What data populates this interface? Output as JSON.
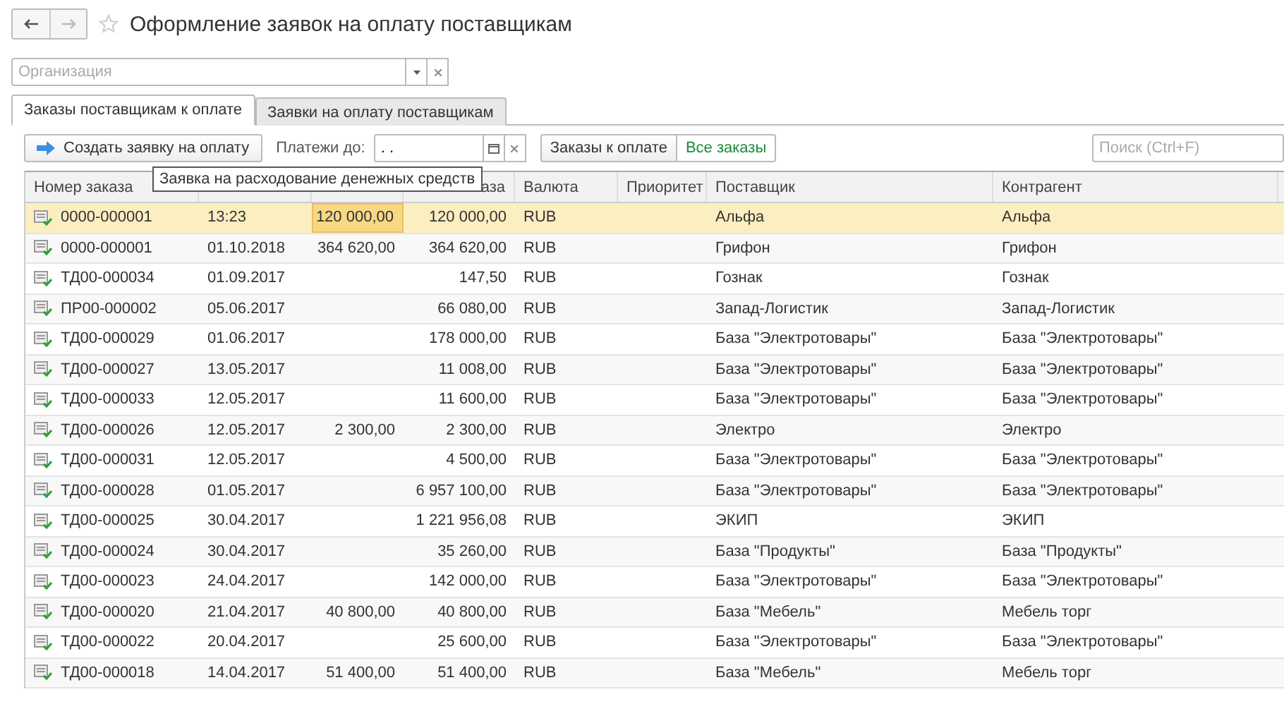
{
  "window": {
    "title": "Оформление заявок на оплату поставщикам"
  },
  "organization": {
    "placeholder": "Организация"
  },
  "tabs": [
    {
      "label": "Заказы поставщикам к оплате",
      "selected": true
    },
    {
      "label": "Заявки на оплату поставщикам",
      "selected": false
    }
  ],
  "toolbar": {
    "create_button": "Создать заявку на оплату",
    "payments_label": "Платежи до:",
    "date_value": ". .",
    "filters": [
      {
        "label": "Заказы к оплате",
        "selected": false
      },
      {
        "label": "Все заказы",
        "selected": true
      }
    ],
    "search_placeholder": "Поиск (Ctrl+F)"
  },
  "tooltip": "Заявка на расходование денежных средств",
  "table": {
    "columns": [
      "Номер заказа",
      "",
      "",
      "аза",
      "Валюта",
      "Приоритет",
      "Поставщик",
      "Контрагент"
    ],
    "rows": [
      {
        "selected": true,
        "cells": [
          "0000-000001",
          "13:23",
          "120 000,00",
          "120 000,00",
          "RUB",
          "",
          "Альфа",
          "Альфа"
        ]
      },
      {
        "selected": false,
        "cells": [
          "0000-000001",
          "01.10.2018",
          "364 620,00",
          "364 620,00",
          "RUB",
          "",
          "Грифон",
          "Грифон"
        ]
      },
      {
        "selected": false,
        "cells": [
          "ТД00-000034",
          "01.09.2017",
          "",
          "147,50",
          "RUB",
          "",
          "Гознак",
          "Гознак"
        ]
      },
      {
        "selected": false,
        "cells": [
          "ПР00-000002",
          "05.06.2017",
          "",
          "66 080,00",
          "RUB",
          "",
          "Запад-Логистик",
          "Запад-Логистик"
        ]
      },
      {
        "selected": false,
        "cells": [
          "ТД00-000029",
          "01.06.2017",
          "",
          "178 000,00",
          "RUB",
          "",
          "База \"Электротовары\"",
          "База \"Электротовары\""
        ]
      },
      {
        "selected": false,
        "cells": [
          "ТД00-000027",
          "13.05.2017",
          "",
          "11 008,00",
          "RUB",
          "",
          "База \"Электротовары\"",
          "База \"Электротовары\""
        ]
      },
      {
        "selected": false,
        "cells": [
          "ТД00-000033",
          "12.05.2017",
          "",
          "11 600,00",
          "RUB",
          "",
          "База \"Электротовары\"",
          "База \"Электротовары\""
        ]
      },
      {
        "selected": false,
        "cells": [
          "ТД00-000026",
          "12.05.2017",
          "2 300,00",
          "2 300,00",
          "RUB",
          "",
          "Электро",
          "Электро"
        ]
      },
      {
        "selected": false,
        "cells": [
          "ТД00-000031",
          "12.05.2017",
          "",
          "4 500,00",
          "RUB",
          "",
          "База \"Электротовары\"",
          "База \"Электротовары\""
        ]
      },
      {
        "selected": false,
        "cells": [
          "ТД00-000028",
          "01.05.2017",
          "",
          "6 957 100,00",
          "RUB",
          "",
          "База \"Электротовары\"",
          "База \"Электротовары\""
        ]
      },
      {
        "selected": false,
        "cells": [
          "ТД00-000025",
          "30.04.2017",
          "",
          "1 221 956,08",
          "RUB",
          "",
          "ЭКИП",
          "ЭКИП"
        ]
      },
      {
        "selected": false,
        "cells": [
          "ТД00-000024",
          "30.04.2017",
          "",
          "35 260,00",
          "RUB",
          "",
          "База \"Продукты\"",
          "База \"Продукты\""
        ]
      },
      {
        "selected": false,
        "cells": [
          "ТД00-000023",
          "24.04.2017",
          "",
          "142 000,00",
          "RUB",
          "",
          "База \"Электротовары\"",
          "База \"Электротовары\""
        ]
      },
      {
        "selected": false,
        "cells": [
          "ТД00-000020",
          "21.04.2017",
          "40 800,00",
          "40 800,00",
          "RUB",
          "",
          "База \"Мебель\"",
          "Мебель торг"
        ]
      },
      {
        "selected": false,
        "cells": [
          "ТД00-000022",
          "20.04.2017",
          "",
          "25 600,00",
          "RUB",
          "",
          "База \"Электротовары\"",
          "База \"Электротовары\""
        ]
      },
      {
        "selected": false,
        "cells": [
          "ТД00-000018",
          "14.04.2017",
          "51 400,00",
          "51 400,00",
          "RUB",
          "",
          "База \"Мебель\"",
          "Мебель торг"
        ]
      }
    ]
  }
}
